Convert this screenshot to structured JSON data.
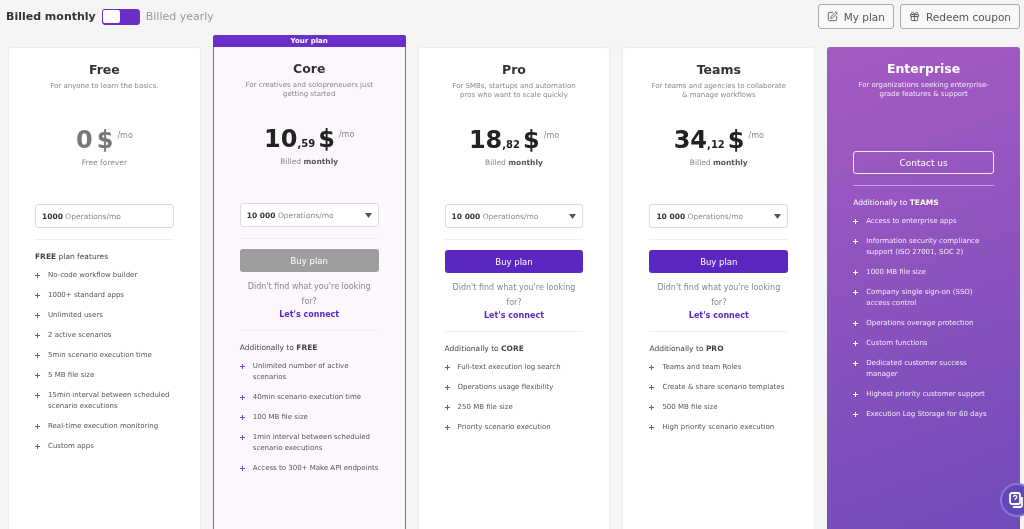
{
  "billing": {
    "options": [
      {
        "label": "Billed monthly",
        "selected": true
      },
      {
        "label": "Billed yearly",
        "selected": false
      }
    ]
  },
  "actions": [
    {
      "kind": "edit",
      "label": "My plan"
    },
    {
      "kind": "gift",
      "label": "Redeem coupon"
    }
  ],
  "plans": [
    {
      "kind": "free",
      "name": "Free",
      "current": false,
      "description": "For anyone to learn the basics.",
      "price": {
        "integer": "0",
        "currency": "$",
        "unit": "/mo"
      },
      "price_note": "Free forever",
      "operations": {
        "amount": "1000",
        "unit": "Operations/mo",
        "dropdown": false
      },
      "features_heading": "**FREE** plan features",
      "features": [
        "No-code workflow builder",
        "1000+ standard apps",
        "Unlimited users",
        "2 active scenarios",
        "5min scenario execution time",
        "5 MB file size",
        "15min interval between scheduled scenario executions",
        "Real-time execution monitoring",
        "Custom apps"
      ]
    },
    {
      "kind": "paid",
      "name": "Core",
      "current": true,
      "badge": "Your plan",
      "description": "For creatives and solopreneuers just getting started",
      "price": {
        "integer": "10",
        "decimals": ",59",
        "currency": "$",
        "unit": "/mo"
      },
      "price_note": "Billed **monthly**",
      "operations": {
        "amount": "10 000",
        "unit": "Operations/mo",
        "dropdown": true
      },
      "button": {
        "label": "Buy plan",
        "disabled": true
      },
      "help_text": "Didn't find what you're looking for?",
      "link": "Let's connect",
      "features_heading": "Additionally to **FREE**",
      "features": [
        "Unlimited number of active scenarios",
        "40min scenario execution time",
        "100 MB file size",
        "1min interval between scheduled scenario executions",
        "Access to 300+ Make API endpoints"
      ]
    },
    {
      "kind": "paid",
      "name": "Pro",
      "current": false,
      "description": "For SMBs, startups and automation pros who want to scale quickly",
      "price": {
        "integer": "18",
        "decimals": ",82",
        "currency": "$",
        "unit": "/mo"
      },
      "price_note": "Billed **monthly**",
      "operations": {
        "amount": "10 000",
        "unit": "Operations/mo",
        "dropdown": true
      },
      "button": {
        "label": "Buy plan",
        "disabled": false
      },
      "help_text": "Didn't find what you're looking for?",
      "link": "Let's connect",
      "features_heading": "Additionally to **CORE**",
      "features": [
        "Full-text execution log search",
        "Operations usage flexibility",
        "250 MB file size",
        "Priority scenario execution"
      ]
    },
    {
      "kind": "paid",
      "name": "Teams",
      "current": false,
      "description": "For teams and agencies to collaborate & manage workflows",
      "price": {
        "integer": "34",
        "decimals": ",12",
        "currency": "$",
        "unit": "/mo"
      },
      "price_note": "Billed **monthly**",
      "operations": {
        "amount": "10 000",
        "unit": "Operations/mo",
        "dropdown": true
      },
      "button": {
        "label": "Buy plan",
        "disabled": false
      },
      "help_text": "Didn't find what you're looking for?",
      "link": "Let's connect",
      "features_heading": "Additionally to **PRO**",
      "features": [
        "Teams and team Roles",
        "Create & share scenario templates",
        "500 MB file size",
        "High priority scenario execution"
      ]
    },
    {
      "kind": "enterprise",
      "name": "Enterprise",
      "current": false,
      "description": "For organizations seeking enterprise-grade features & support",
      "button": {
        "label": "Contact us"
      },
      "features_heading": "Additionally to **TEAMS**",
      "features": [
        "Access to enterprise apps",
        "Information security compliance support (ISO 27001, SOC 2)",
        "1000 MB file size",
        "Company single sign-on (SSO) access control",
        "Operations overage protection",
        "Custom functions",
        "Dedicated customer success manager",
        "Highest priority customer support",
        "Execution Log Storage for 60 days"
      ]
    }
  ]
}
